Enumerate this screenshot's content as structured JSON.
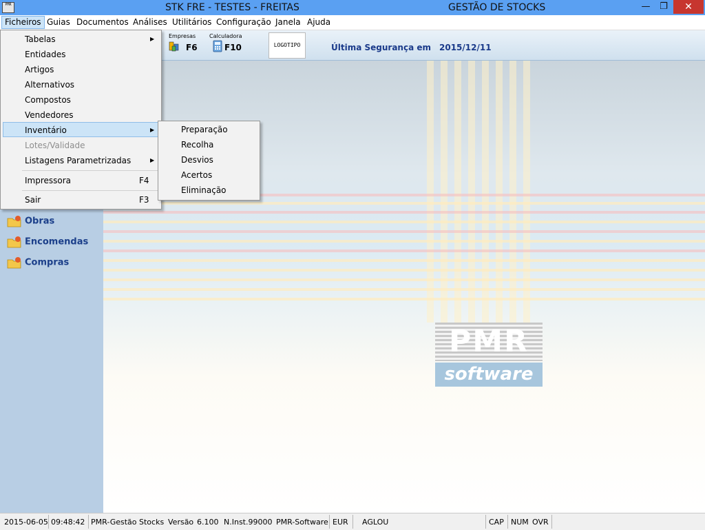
{
  "window": {
    "title_left": "STK FRE - TESTES - FREITAS",
    "title_right": "GESTÃO DE STOCKS",
    "app_icon_text": "PMR",
    "min_glyph": "—",
    "restore_glyph": "❐",
    "close_glyph": "✕"
  },
  "menubar": [
    "Ficheiros",
    "Guias",
    "Documentos",
    "Análises",
    "Utilitários",
    "Configuração",
    "Janela",
    "Ajuda"
  ],
  "toolbar": {
    "empresas_label": "Empresas",
    "empresas_key": "F6",
    "calculadora_label": "Calculadora",
    "calculadora_key": "F10",
    "logotipo": "LOGOTIPO",
    "seguranca_label": "Última Segurança em",
    "seguranca_date": "2015/12/11"
  },
  "file_menu": {
    "items": [
      {
        "label": "Tabelas",
        "shortcut": "",
        "submenu": true
      },
      {
        "label": "Entidades",
        "shortcut": "",
        "submenu": false
      },
      {
        "label": "Artigos",
        "shortcut": "",
        "submenu": false
      },
      {
        "label": "Alternativos",
        "shortcut": "",
        "submenu": false
      },
      {
        "label": "Compostos",
        "shortcut": "",
        "submenu": false
      },
      {
        "label": "Vendedores",
        "shortcut": "",
        "submenu": false
      },
      {
        "label": "Inventário",
        "shortcut": "",
        "submenu": true
      },
      {
        "label": "Lotes/Validade",
        "shortcut": "",
        "submenu": false
      },
      {
        "label": "Listagens Parametrizadas",
        "shortcut": "",
        "submenu": true
      },
      {
        "label": "Impressora",
        "shortcut": "F4",
        "submenu": false
      },
      {
        "label": "Sair",
        "shortcut": "F3",
        "submenu": false
      }
    ]
  },
  "inventario_submenu": [
    "Preparação",
    "Recolha",
    "Desvios",
    "Acertos",
    "Eliminação"
  ],
  "sidebar": [
    "Obras",
    "Encomendas",
    "Compras"
  ],
  "logo": {
    "pmr": "PMR",
    "software": "software"
  },
  "statusbar": {
    "date": "2015-06-05",
    "time": "09:48:42",
    "app": "PMR-Gestão Stocks",
    "version_label": "Versão",
    "version": "6.100",
    "install": "N.Inst.99000",
    "company": "PMR-Software",
    "currency": "EUR",
    "user": "AGLOU",
    "cap": "CAP",
    "num": "NUM",
    "ovr": "OVR"
  }
}
